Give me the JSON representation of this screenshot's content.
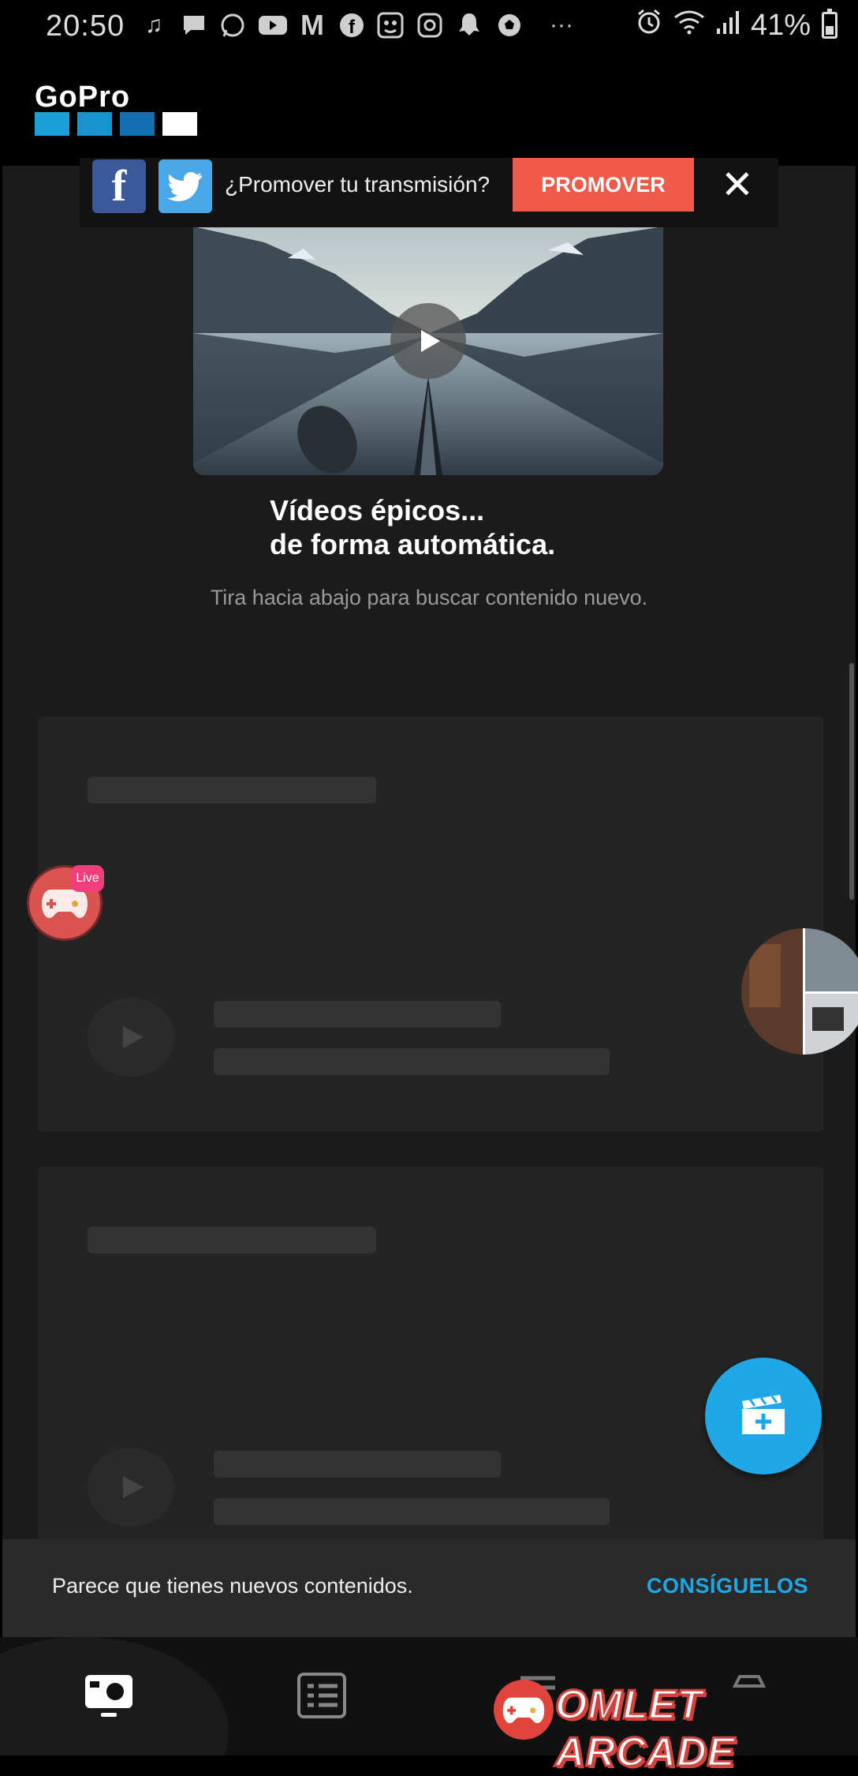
{
  "status_bar": {
    "time": "20:50",
    "battery": "41%",
    "battery_level": 0.41,
    "notification_icons": [
      "music-icon",
      "message-icon",
      "whatsapp-icon",
      "youtube-icon",
      "mcdonalds-icon",
      "facebook-icon",
      "mask-icon",
      "instagram-icon",
      "ghost-icon",
      "soccer-icon",
      "more-icon"
    ]
  },
  "header": {
    "logo_text": "GoPro"
  },
  "promo": {
    "question": "¿Promover tu transmisión?",
    "button": "PROMOVER",
    "facebook_glyph": "f",
    "close_glyph": "✕"
  },
  "hero": {
    "title_line1": "Vídeos épicos...",
    "title_line2": "de forma automática.",
    "subtitle": "Tira hacia abajo para buscar contenido nuevo."
  },
  "live": {
    "badge": "Live"
  },
  "snackbar": {
    "message": "Parece que tienes nuevos contenidos.",
    "action": "CONSÍGUELOS"
  },
  "watermark": {
    "text": "OMLET ARCADE"
  },
  "colors": {
    "accent_blue": "#1ea8e8",
    "promo_red": "#f05a4a",
    "background": "#1b1b1b",
    "card": "#242424"
  }
}
